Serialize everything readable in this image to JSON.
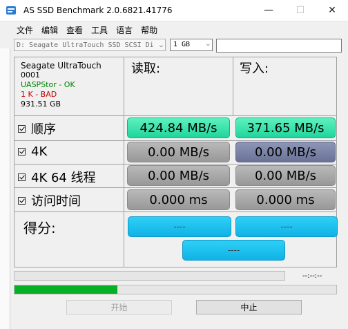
{
  "window": {
    "title": "AS SSD Benchmark 2.0.6821.41776",
    "minimize_glyph": "—",
    "maximize_glyph": "☐",
    "close_glyph": "✕"
  },
  "menu": [
    "文件",
    "编辑",
    "查看",
    "工具",
    "语言",
    "帮助"
  ],
  "toolbar": {
    "drive_select": "D: Seagate UltraTouch SSD SCSI Di",
    "size_select": "1 GB",
    "text_field_value": ""
  },
  "drive_info": {
    "name": "Seagate UltraTouch",
    "firmware": "0001",
    "driver_status": "UASPStor - OK",
    "alignment_status": "1 K - BAD",
    "capacity": "931.51 GB",
    "ok_color": "#008000",
    "bad_color": "#c00000"
  },
  "columns": {
    "read": "读取:",
    "write": "写入:"
  },
  "rows": [
    {
      "label": "顺序",
      "read": "424.84 MB/s",
      "write": "371.65 MB/s"
    },
    {
      "label": "4K",
      "read": "0.00 MB/s",
      "write": "0.00 MB/s"
    },
    {
      "label": "4K 64 线程",
      "read": "0.00 MB/s",
      "write": "0.00 MB/s"
    },
    {
      "label": "访问时间",
      "read": "0.000 ms",
      "write": "0.000 ms"
    }
  ],
  "score": {
    "label": "得分:",
    "read": "----",
    "write": "----",
    "total": "----"
  },
  "progress": {
    "current_fraction": 0,
    "time": "--:--:--",
    "overall_fraction": 0.32
  },
  "buttons": {
    "start": "开始",
    "abort": "中止"
  },
  "colors": {
    "good_value": "#1fd69a",
    "score": "#0fb2e6",
    "progress": "#06b025"
  }
}
